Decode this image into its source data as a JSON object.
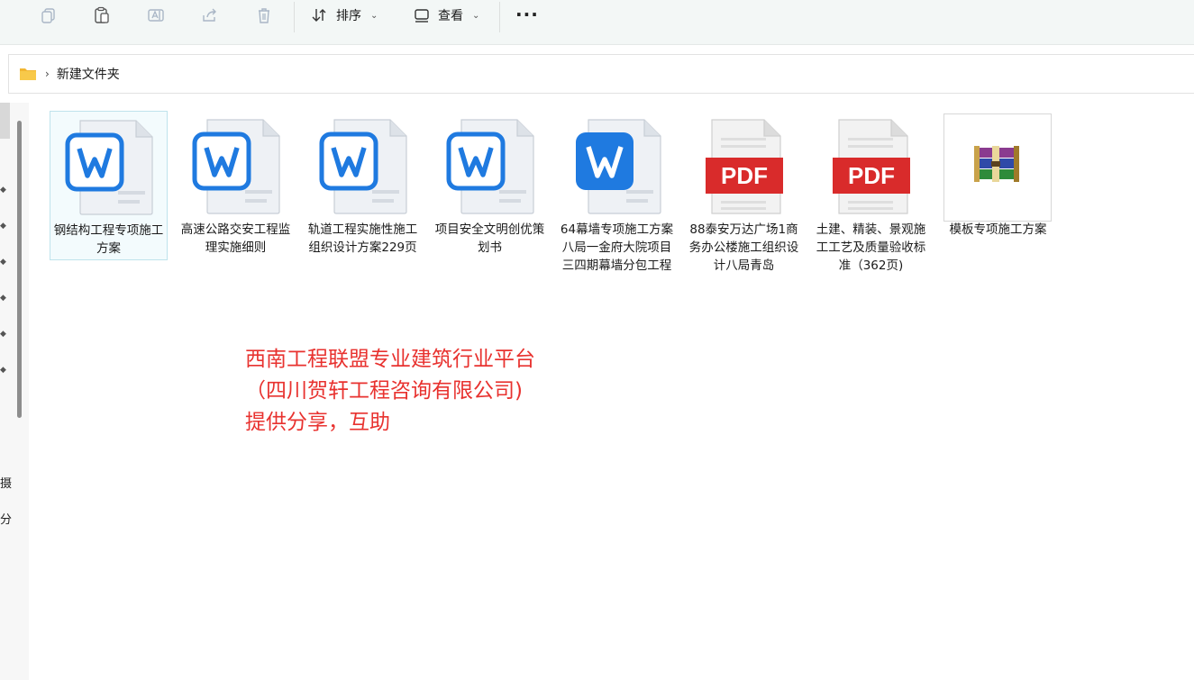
{
  "toolbar": {
    "sort_label": "排序",
    "view_label": "查看",
    "more_label": "···"
  },
  "address": {
    "path": "新建文件夹"
  },
  "left_pane": {
    "partial_items": [
      "摄",
      "分"
    ]
  },
  "files": [
    {
      "name": "钢结构工程专项施工方案",
      "type": "word-outline",
      "selected": true
    },
    {
      "name": "高速公路交安工程监理实施细则",
      "type": "word-outline"
    },
    {
      "name": "轨道工程实施性施工组织设计方案229页",
      "type": "word-outline"
    },
    {
      "name": "项目安全文明创优策划书",
      "type": "word-outline"
    },
    {
      "name": "64幕墙专项施工方案八局一金府大院项目三四期幕墙分包工程",
      "type": "word-filled"
    },
    {
      "name": "88泰安万达广场1商务办公楼施工组织设计八局青岛",
      "type": "pdf",
      "badge": "PDF"
    },
    {
      "name": "土建、精装、景观施工工艺及质量验收标准（362页)",
      "type": "pdf",
      "badge": "PDF"
    },
    {
      "name": "模板专项施工方案",
      "type": "rar"
    }
  ],
  "watermark": {
    "line1": "西南工程联盟专业建筑行业平台",
    "line2": "（四川贺轩工程咨询有限公司)",
    "line3": "提供分享，互助"
  },
  "colors": {
    "word_blue": "#1f7ae0",
    "pdf_red": "#d92b2b",
    "watermark_red": "#e8322f",
    "folder_yellow": "#f2b632"
  }
}
